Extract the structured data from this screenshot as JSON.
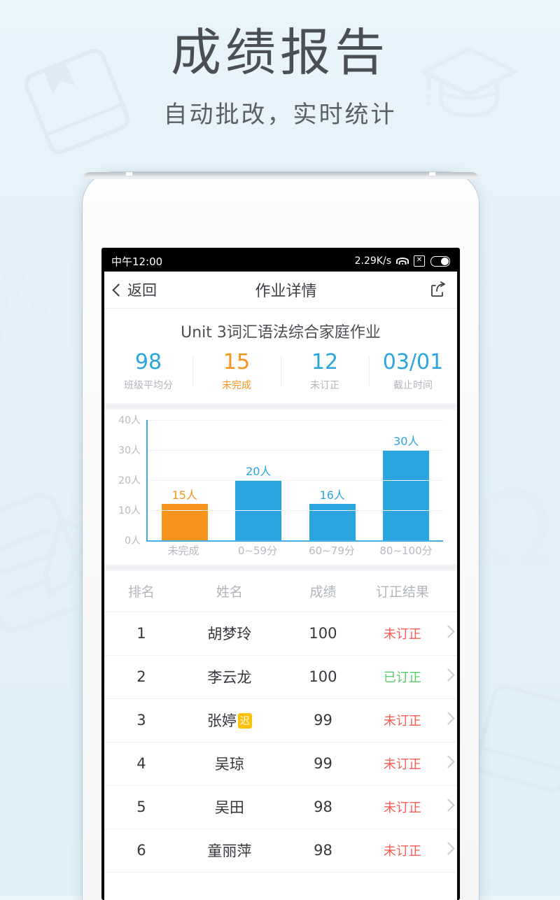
{
  "poster": {
    "title": "成绩报告",
    "subtitle": "自动批改，实时统计"
  },
  "colors": {
    "blue": "#2ba5e0",
    "orange": "#f7941d",
    "red": "#fc5b54",
    "green": "#55cc6a",
    "badge_yellow": "#ffc107",
    "muted": "#b0b5bb",
    "background": "#e3f1fa"
  },
  "statusbar": {
    "time": "中午12:00",
    "network_speed": "2.29K/s",
    "wifi_icon": "wifi-icon",
    "sim_icon": "sim-disabled-icon",
    "battery_icon": "battery-icon"
  },
  "navbar": {
    "back_label": "返回",
    "back_icon": "chevron-left-icon",
    "title": "作业详情",
    "share_icon": "share-icon"
  },
  "summary": {
    "homework_title": "Unit 3词汇语法综合家庭作业",
    "stats": [
      {
        "value": "98",
        "label": "班级平均分",
        "color": "#2ba5e0",
        "label_color": "#b0b5bb"
      },
      {
        "value": "15",
        "label": "未完成",
        "color": "#f7941d",
        "label_color": "#f7941d"
      },
      {
        "value": "12",
        "label": "未订正",
        "color": "#2ba5e0",
        "label_color": "#b0b5bb"
      },
      {
        "value": "03/01",
        "label": "截止时间",
        "color": "#2ba5e0",
        "label_color": "#b0b5bb"
      }
    ]
  },
  "chart_data": {
    "type": "bar",
    "title": "",
    "xlabel": "",
    "ylabel": "人",
    "categories": [
      "未完成",
      "0~59分",
      "60~79分",
      "80~100分"
    ],
    "values": [
      15,
      20,
      16,
      30
    ],
    "bar_pixel_values": [
      12,
      20,
      12,
      30
    ],
    "data_labels": [
      "15人",
      "20人",
      "16人",
      "30人"
    ],
    "colors": [
      "#f7941d",
      "#2ba5e0",
      "#2ba5e0",
      "#2ba5e0"
    ],
    "label_colors": [
      "#f7941d",
      "#2ba5e0",
      "#2ba5e0",
      "#2ba5e0"
    ],
    "ylim": [
      0,
      40
    ],
    "yticks": [
      0,
      10,
      20,
      30,
      40
    ],
    "ytick_labels": [
      "0人",
      "10人",
      "20人",
      "30人",
      "40人"
    ],
    "grid": true,
    "legend": "none",
    "axis_color": "#3fb0e8"
  },
  "table": {
    "headers": [
      "排名",
      "姓名",
      "成绩",
      "订正结果"
    ],
    "arrow_icon": "chevron-right-icon",
    "rows": [
      {
        "rank": "1",
        "name": "胡梦玲",
        "badge": "",
        "score": "100",
        "result": "未订正",
        "result_color": "#fc5b54"
      },
      {
        "rank": "2",
        "name": "李云龙",
        "badge": "",
        "score": "100",
        "result": "已订正",
        "result_color": "#55cc6a"
      },
      {
        "rank": "3",
        "name": "张婷",
        "badge": "迟",
        "score": "99",
        "result": "未订正",
        "result_color": "#fc5b54"
      },
      {
        "rank": "4",
        "name": "吴琼",
        "badge": "",
        "score": "99",
        "result": "未订正",
        "result_color": "#fc5b54"
      },
      {
        "rank": "5",
        "name": "吴田",
        "badge": "",
        "score": "98",
        "result": "未订正",
        "result_color": "#fc5b54"
      },
      {
        "rank": "6",
        "name": "童丽萍",
        "badge": "",
        "score": "98",
        "result": "未订正",
        "result_color": "#fc5b54"
      }
    ]
  },
  "decorations": [
    {
      "icon": "book-icon"
    },
    {
      "icon": "graduation-cap-icon"
    },
    {
      "icon": "fx-formula-icon",
      "glyph": "fx"
    },
    {
      "icon": "omega-icon",
      "glyph": "Ω"
    },
    {
      "icon": "note-pencil-icon"
    }
  ]
}
